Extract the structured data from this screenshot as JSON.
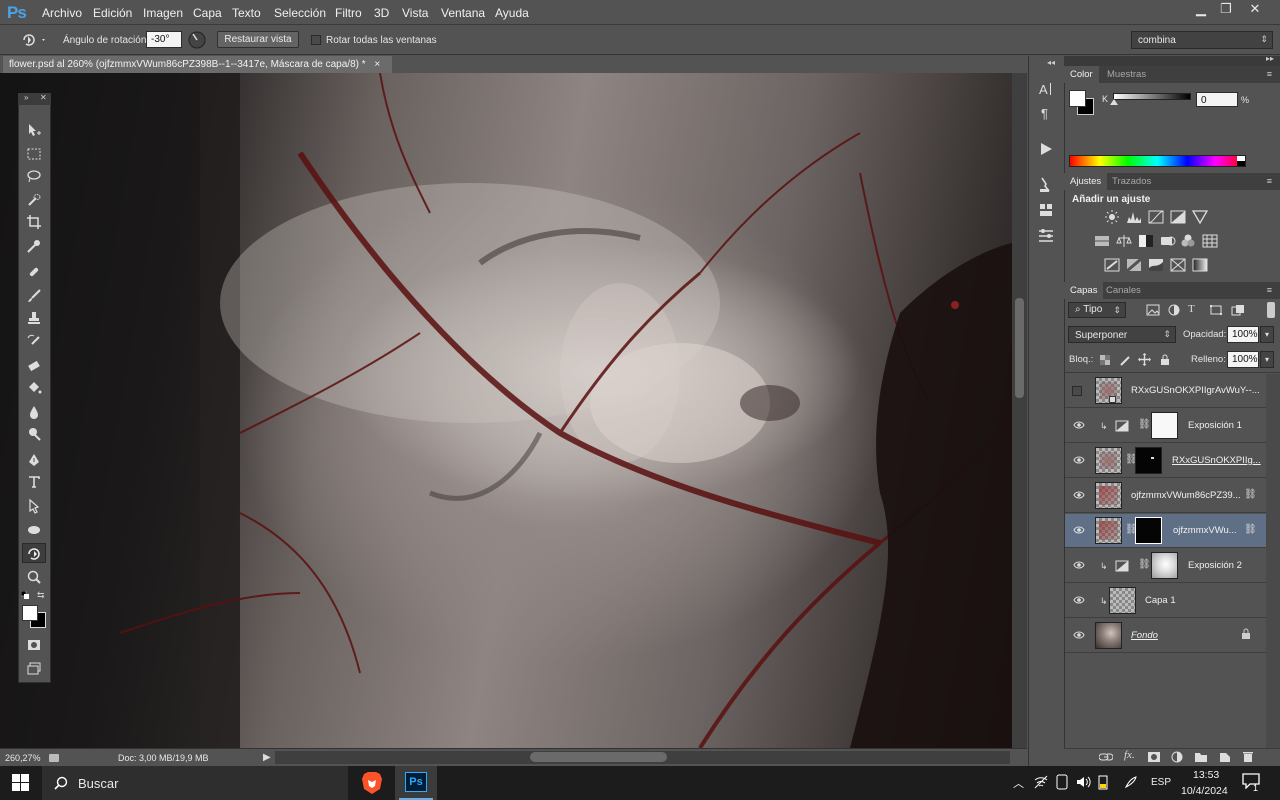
{
  "app": {
    "logo": "Ps"
  },
  "menu": [
    "Archivo",
    "Edición",
    "Imagen",
    "Capa",
    "Texto",
    "Selección",
    "Filtro",
    "3D",
    "Vista",
    "Ventana",
    "Ayuda"
  ],
  "window_controls": {
    "minimize": "▁",
    "restore": "❐",
    "close": "✕"
  },
  "options": {
    "rotation_label": "Ángulo de rotación:",
    "rotation_value": "-30°",
    "reset_view": "Restaurar vista",
    "rotate_all": "Rotar todas las ventanas",
    "workspace": "combina"
  },
  "document": {
    "tab_title": "flower.psd al 260% (ojfzmmxVWum86cPZ398B--1--3417e, Máscara de capa/8) *",
    "close": "×"
  },
  "status": {
    "zoom": "260,27%",
    "doc": "Doc: 3,00 MB/19,9 MB"
  },
  "color_panel": {
    "tabs": [
      "Color",
      "Muestras"
    ],
    "channel": "K",
    "value": "0",
    "unit": "%"
  },
  "adjust_panel": {
    "tabs": [
      "Ajustes",
      "Trazados"
    ],
    "title": "Añadir un ajuste"
  },
  "layers_panel": {
    "tabs": [
      "Capas",
      "Canales"
    ],
    "filter": "Tipo",
    "blend_mode": "Superponer",
    "opacity_label": "Opacidad:",
    "opacity": "100%",
    "lock_label": "Bloq.:",
    "fill_label": "Relleno:",
    "fill": "100%",
    "layers": [
      {
        "name": "RXxGUSnOKXPIIgrAvWuY--..."
      },
      {
        "name": "Exposición 1"
      },
      {
        "name": "RXxGUSnOKXPIIg..."
      },
      {
        "name": "ojfzmmxVWum86cPZ39..."
      },
      {
        "name": "ojfzmmxVWu..."
      },
      {
        "name": "Exposición 2"
      },
      {
        "name": "Capa 1"
      },
      {
        "name": "Fondo"
      }
    ]
  },
  "taskbar": {
    "search": "Buscar",
    "lang": "ESP",
    "time": "13:53",
    "date": "10/4/2024",
    "notif_count": "1",
    "ps_label": "Ps"
  }
}
